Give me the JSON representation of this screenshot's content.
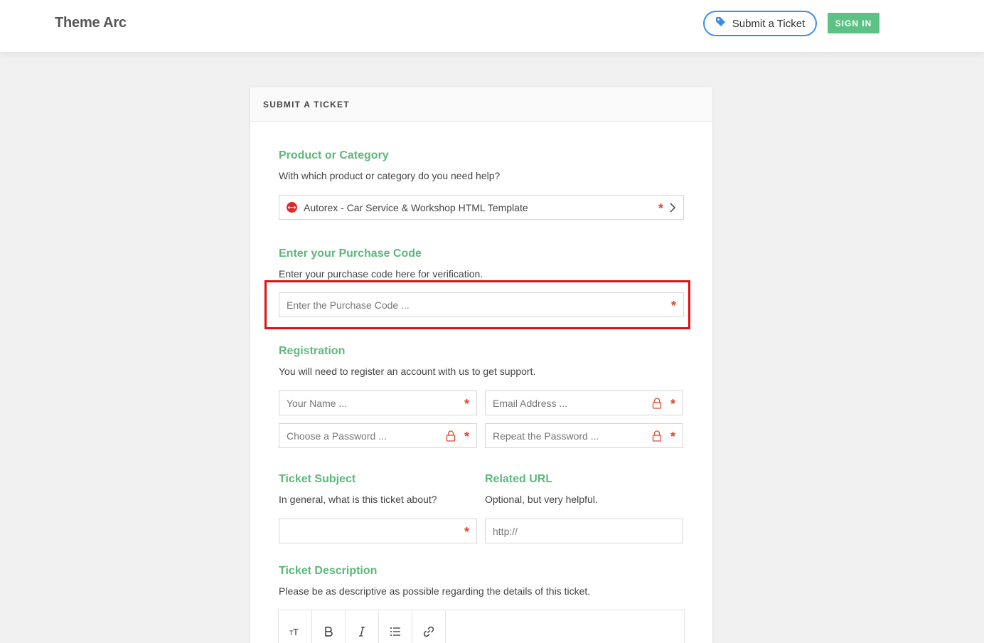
{
  "header": {
    "brand": "Theme Arc",
    "submit_ticket_label": "Submit a Ticket",
    "sign_in_label": "SIGN IN"
  },
  "card": {
    "title": "SUBMIT A TICKET"
  },
  "product": {
    "title": "Product or Category",
    "description": "With which product or category do you need help?",
    "selected": "Autorex - Car Service & Workshop HTML Template"
  },
  "purchase": {
    "title": "Enter your Purchase Code",
    "description": "Enter your purchase code here for verification.",
    "placeholder": "Enter the Purchase Code ..."
  },
  "registration": {
    "title": "Registration",
    "description": "You will need to register an account with us to get support.",
    "name_placeholder": "Your Name ...",
    "email_placeholder": "Email Address ...",
    "password_placeholder": "Choose a Password ...",
    "repeat_placeholder": "Repeat the Password ..."
  },
  "subject": {
    "title": "Ticket Subject",
    "description": "In general, what is this ticket about?"
  },
  "related_url": {
    "title": "Related URL",
    "description": "Optional, but very helpful.",
    "placeholder": "http://"
  },
  "ticket_description": {
    "title": "Ticket Description",
    "description": "Please be as descriptive as possible regarding the details of this ticket."
  },
  "editor_toolbar": [
    "text-size-icon",
    "bold-icon",
    "italic-icon",
    "list-icon",
    "link-icon"
  ],
  "colors": {
    "accent_green": "#5cb87a",
    "sign_in_bg": "#5cc185",
    "required_red": "#e0452a",
    "highlight_red": "#e01111",
    "ticket_button_border": "#3a8ee6"
  }
}
